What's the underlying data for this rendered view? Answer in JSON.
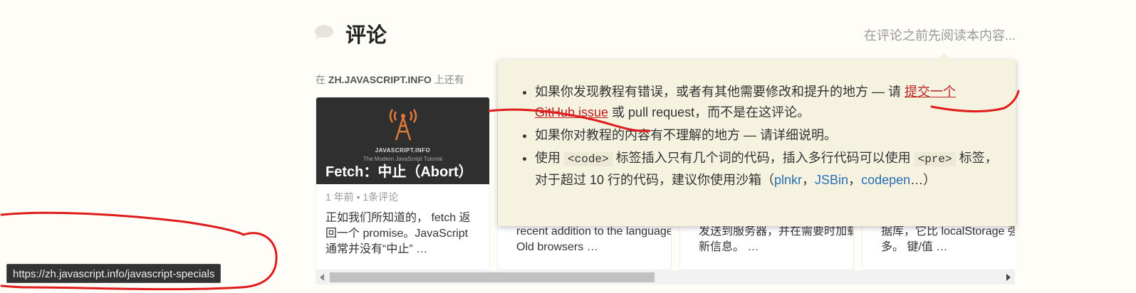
{
  "header": {
    "title": "评论",
    "read_first": "在评论之前先阅读本内容..."
  },
  "also_on": {
    "prefix": "在",
    "site": "ZH.JAVASCRIPT.INFO",
    "suffix": "上还有"
  },
  "cards": [
    {
      "thumb_site": "JAVASCRIPT.INFO",
      "thumb_tagline": "The Modern JavaScript Tutorial",
      "title": "Fetch：中止（Abort）",
      "meta": "1 年前 • 1条评论",
      "excerpt": "正如我们所知道的， fetch 返回一个 promise。JavaScript 通常并没有“中止” …"
    },
    {
      "excerpt": "recent addition to the language. Old browsers …"
    },
    {
      "excerpt": "发送到服务器，并在需要时加载新信息。 …"
    },
    {
      "excerpt": "据库，它比 localStorage 强大得多。 键/值 …"
    }
  ],
  "tooltip": {
    "item1_text_a": "如果你发现教程有错误，或者有其他需要修改和提升的地方 — 请 ",
    "item1_link": "提交一个 GitHub issue",
    "item1_text_b": " 或 pull request，而不是在这评论。",
    "item2_text": "如果你对教程的内容有不理解的地方 — 请详细说明。",
    "item3_text_a": "使用 ",
    "item3_code1": "<code>",
    "item3_text_b": " 标签插入只有几个词的代码，插入多行代码可以使用 ",
    "item3_code2": "<pre>",
    "item3_text_c": " 标签，对于超过 10 行的代码，建议你使用沙箱（",
    "link_plnkr": "plnkr",
    "sep1": "，",
    "link_jsbin": "JSBin",
    "sep2": "，",
    "link_codepen": "codepen",
    "item3_text_d": "…）"
  },
  "status_url": "https://zh.javascript.info/javascript-specials",
  "colors": {
    "background": "#fffdf7",
    "tooltip_bg": "#f5f3e0",
    "link": "#2a6fb5",
    "annotation_red": "#e01b1b"
  }
}
